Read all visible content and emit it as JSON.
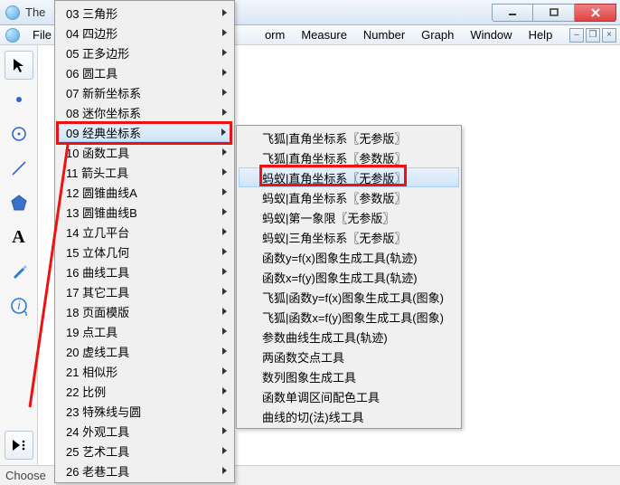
{
  "window": {
    "title_prefix": "The"
  },
  "menubar": {
    "items": [
      "File"
    ],
    "right_items": [
      "orm",
      "Measure",
      "Number",
      "Graph",
      "Window",
      "Help"
    ]
  },
  "statusbar": {
    "text": "Choose"
  },
  "dropdown": {
    "items": [
      {
        "label": "03 三角形",
        "arrow": true
      },
      {
        "label": "04 四边形",
        "arrow": true
      },
      {
        "label": "05 正多边形",
        "arrow": true
      },
      {
        "label": "06 圆工具",
        "arrow": true
      },
      {
        "label": "07 新新坐标系",
        "arrow": true
      },
      {
        "label": "08 迷你坐标系",
        "arrow": true
      },
      {
        "label": "09 经典坐标系",
        "arrow": true,
        "highlight": true
      },
      {
        "label": "10 函数工具",
        "arrow": true
      },
      {
        "label": "11 箭头工具",
        "arrow": true
      },
      {
        "label": "12 圆锥曲线A",
        "arrow": true
      },
      {
        "label": "13 圆锥曲线B",
        "arrow": true
      },
      {
        "label": "14 立几平台",
        "arrow": true
      },
      {
        "label": "15 立体几何",
        "arrow": true
      },
      {
        "label": "16 曲线工具",
        "arrow": true
      },
      {
        "label": "17 其它工具",
        "arrow": true
      },
      {
        "label": "18 页面模版",
        "arrow": true
      },
      {
        "label": "19 点工具",
        "arrow": true
      },
      {
        "label": "20 虚线工具",
        "arrow": true
      },
      {
        "label": "21 相似形",
        "arrow": true
      },
      {
        "label": "22 比例",
        "arrow": true
      },
      {
        "label": "23 特殊线与圆",
        "arrow": true
      },
      {
        "label": "24 外观工具",
        "arrow": true
      },
      {
        "label": "25 艺术工具",
        "arrow": true
      },
      {
        "label": "26 老巷工具",
        "arrow": true
      }
    ]
  },
  "submenu": {
    "items": [
      {
        "label": "飞狐|直角坐标系〖无参版〗"
      },
      {
        "label": "飞狐|直角坐标系〖参数版〗"
      },
      {
        "label": "蚂蚁|直角坐标系〖无参版〗",
        "highlight": true
      },
      {
        "label": "蚂蚁|直角坐标系〖参数版〗"
      },
      {
        "label": "蚂蚁|第一象限〖无参版〗"
      },
      {
        "label": "蚂蚁|三角坐标系〖无参版〗"
      },
      {
        "label": "函数y=f(x)图象生成工具(轨迹)"
      },
      {
        "label": "函数x=f(y)图象生成工具(轨迹)"
      },
      {
        "label": "飞狐|函数y=f(x)图象生成工具(图象)"
      },
      {
        "label": "飞狐|函数x=f(y)图象生成工具(图象)"
      },
      {
        "label": "参数曲线生成工具(轨迹)"
      },
      {
        "label": "两函数交点工具"
      },
      {
        "label": "数列图象生成工具"
      },
      {
        "label": "函数单调区间配色工具"
      },
      {
        "label": "曲线的切(法)线工具"
      }
    ]
  },
  "tools": {
    "names": [
      "arrow-tool",
      "point-tool",
      "circle-tool",
      "line-tool",
      "polygon-tool",
      "text-tool",
      "marker-tool",
      "info-tool",
      "custom-tool"
    ]
  }
}
